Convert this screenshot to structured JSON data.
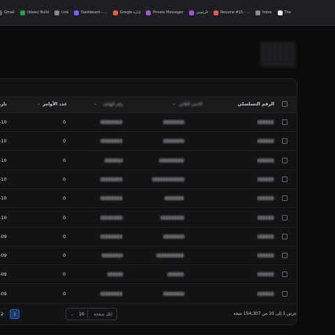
{
  "bookmarks": [
    {
      "label": "Gmail",
      "icon": "mail-icon",
      "color": "#5f6368"
    },
    {
      "label": "(Ideas) Build",
      "icon": "plus-icon",
      "color": "#24a148"
    },
    {
      "label": "Link",
      "icon": "folder-icon",
      "color": "#8a8a92"
    },
    {
      "label": "Dashboard – ...",
      "icon": "dashboard-icon",
      "color": "#7b5cff"
    },
    {
      "label": "Google إدارة",
      "icon": "google-icon",
      "color": "#e25b45"
    },
    {
      "label": "Private Messages",
      "icon": "message-icon",
      "color": "#a25bd8"
    },
    {
      "label": "الرئيسي",
      "icon": "home-icon",
      "color": "#9a58d6"
    },
    {
      "label": "Resume #15 - ...",
      "icon": "file-icon",
      "color": "#e05a4b"
    },
    {
      "label": "Inbox",
      "icon": "inbox-icon",
      "color": "#8a8a92"
    },
    {
      "label": "The",
      "icon": "logo-icon",
      "color": "#e8e8e8"
    }
  ],
  "table": {
    "columns": {
      "serial": "الرقم التسلسلي",
      "name": "الاسم الثلاثي",
      "phone": "رقم الهاتف",
      "orders": "عدد الأوامر",
      "date": "تاريخ"
    },
    "rows": [
      {
        "orders": "0",
        "date": "-10"
      },
      {
        "orders": "0",
        "date": "-10"
      },
      {
        "orders": "0",
        "date": "-10"
      },
      {
        "orders": "0",
        "date": "-10"
      },
      {
        "orders": "0",
        "date": "-10"
      },
      {
        "orders": "0",
        "date": "-10"
      },
      {
        "orders": "0",
        "date": "-09"
      },
      {
        "orders": "0",
        "date": "-09"
      },
      {
        "orders": "0",
        "date": "-09"
      },
      {
        "orders": "0",
        "date": "-09"
      }
    ]
  },
  "footer": {
    "results_text": "عرض 1 إلى 10 من 154,307 نتيجة",
    "per_page_label": "لكل صفحة",
    "per_page_value": "10",
    "pages": [
      "1",
      "2"
    ]
  },
  "colors": {
    "accent": "#3b82f6",
    "panel_bg": "#131315",
    "page_bg": "#0b0b0c"
  }
}
